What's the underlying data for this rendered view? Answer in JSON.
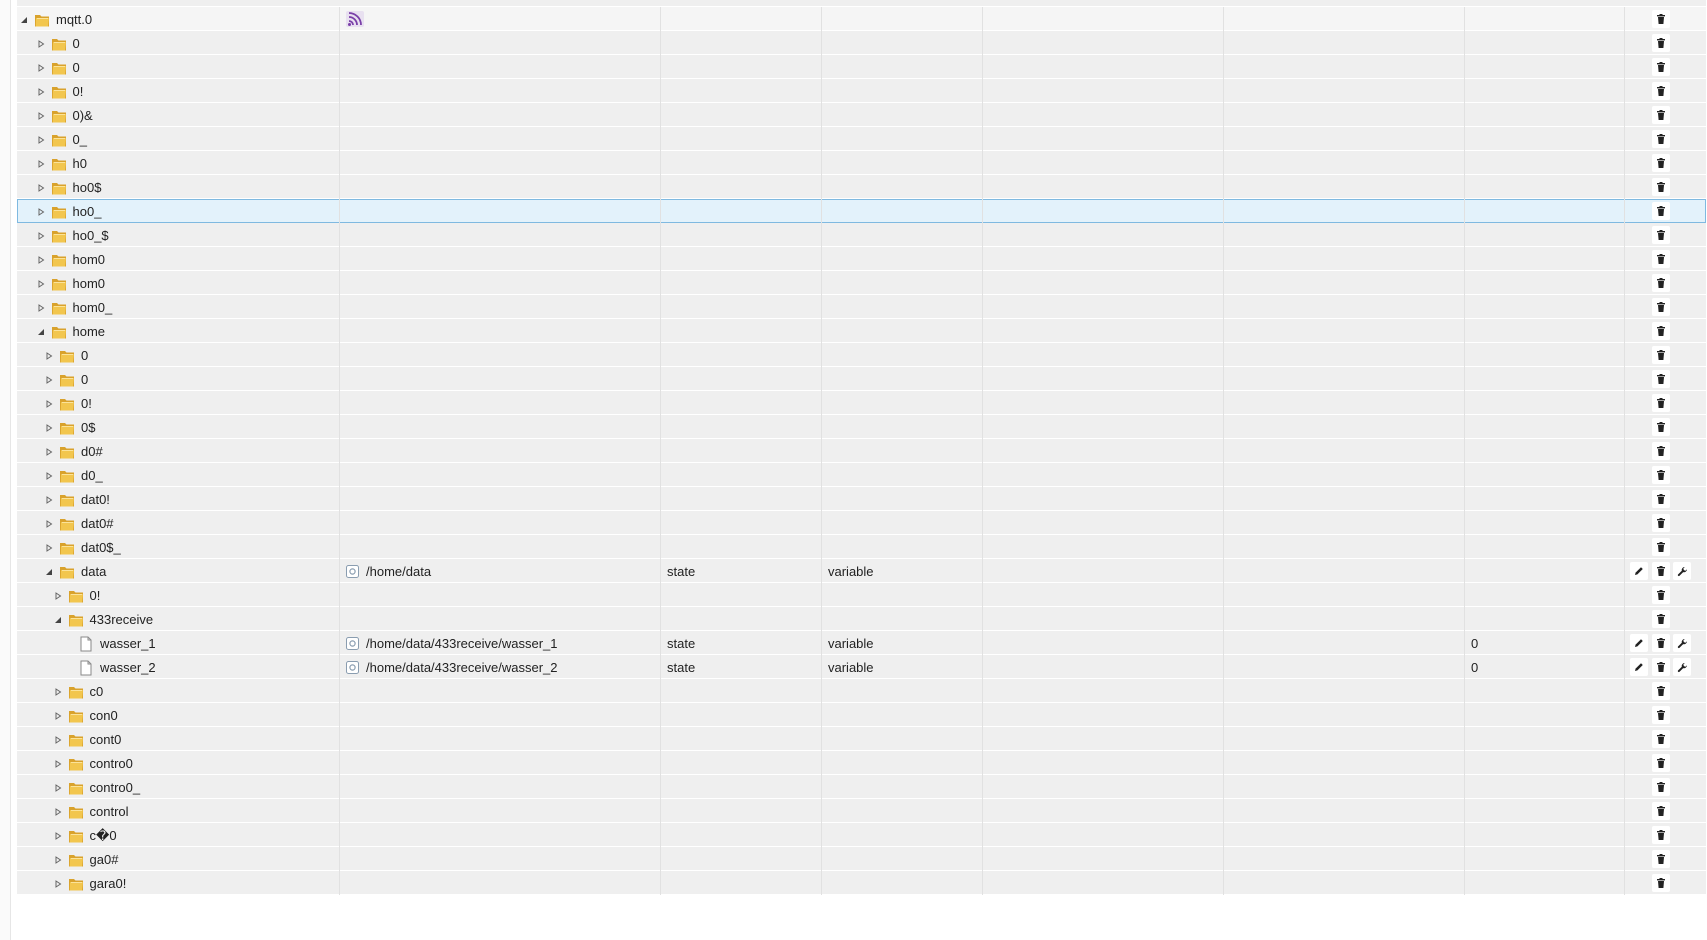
{
  "icons": {
    "folder": "folder-icon",
    "file": "file-icon",
    "state": "state-icon",
    "adapter": "mqtt-adapter-icon",
    "delete": "trash-icon",
    "edit": "pencil-icon",
    "config": "wrench-icon",
    "expanded": "triangle-down-icon",
    "collapsed": "triangle-right-icon"
  },
  "colors": {
    "row_bg": "#efefef",
    "selected_bg": "#e3f2fb",
    "selected_border": "#7fb9e0",
    "folder": "#e9b53c"
  },
  "rows": [
    {
      "name": "mqtt.0",
      "level": 0,
      "toggle": "expanded",
      "icon": "folder",
      "adapter": true,
      "root": true
    },
    {
      "name": "0",
      "level": 1,
      "toggle": "collapsed",
      "icon": "folder"
    },
    {
      "name": "0",
      "level": 1,
      "toggle": "collapsed",
      "icon": "folder"
    },
    {
      "name": "0!",
      "level": 1,
      "toggle": "collapsed",
      "icon": "folder"
    },
    {
      "name": "0)&",
      "level": 1,
      "toggle": "collapsed",
      "icon": "folder"
    },
    {
      "name": "0_",
      "level": 1,
      "toggle": "collapsed",
      "icon": "folder"
    },
    {
      "name": "h0",
      "level": 1,
      "toggle": "collapsed",
      "icon": "folder"
    },
    {
      "name": "ho0$",
      "level": 1,
      "toggle": "collapsed",
      "icon": "folder"
    },
    {
      "name": "ho0_",
      "level": 1,
      "toggle": "collapsed",
      "icon": "folder",
      "selected": true
    },
    {
      "name": "ho0_$",
      "level": 1,
      "toggle": "collapsed",
      "icon": "folder"
    },
    {
      "name": "hom0",
      "level": 1,
      "toggle": "collapsed",
      "icon": "folder"
    },
    {
      "name": "hom0",
      "level": 1,
      "toggle": "collapsed",
      "icon": "folder"
    },
    {
      "name": "hom0_",
      "level": 1,
      "toggle": "collapsed",
      "icon": "folder"
    },
    {
      "name": "home",
      "level": 1,
      "toggle": "expanded",
      "icon": "folder"
    },
    {
      "name": "0",
      "level": 2,
      "toggle": "collapsed",
      "icon": "folder"
    },
    {
      "name": "0",
      "level": 2,
      "toggle": "collapsed",
      "icon": "folder"
    },
    {
      "name": "0!",
      "level": 2,
      "toggle": "collapsed",
      "icon": "folder"
    },
    {
      "name": "0$",
      "level": 2,
      "toggle": "collapsed",
      "icon": "folder"
    },
    {
      "name": "d0#",
      "level": 2,
      "toggle": "collapsed",
      "icon": "folder"
    },
    {
      "name": "d0_",
      "level": 2,
      "toggle": "collapsed",
      "icon": "folder"
    },
    {
      "name": "dat0!",
      "level": 2,
      "toggle": "collapsed",
      "icon": "folder"
    },
    {
      "name": "dat0#",
      "level": 2,
      "toggle": "collapsed",
      "icon": "folder"
    },
    {
      "name": "dat0$_",
      "level": 2,
      "toggle": "collapsed",
      "icon": "folder"
    },
    {
      "name": "data",
      "level": 2,
      "toggle": "expanded",
      "icon": "folder",
      "id": "/home/data",
      "type": "state",
      "role": "variable",
      "actions": [
        "edit",
        "delete",
        "config"
      ]
    },
    {
      "name": "0!",
      "level": 3,
      "toggle": "collapsed",
      "icon": "folder"
    },
    {
      "name": "433receive",
      "level": 3,
      "toggle": "expanded",
      "icon": "folder"
    },
    {
      "name": "wasser_1",
      "level": 4,
      "toggle": "none",
      "icon": "file",
      "id": "/home/data/433receive/wasser_1",
      "type": "state",
      "role": "variable",
      "value": "0",
      "actions": [
        "edit",
        "delete",
        "config"
      ]
    },
    {
      "name": "wasser_2",
      "level": 4,
      "toggle": "none",
      "icon": "file",
      "id": "/home/data/433receive/wasser_2",
      "type": "state",
      "role": "variable",
      "value": "0",
      "actions": [
        "edit",
        "delete",
        "config"
      ]
    },
    {
      "name": "c0",
      "level": 3,
      "toggle": "collapsed",
      "icon": "folder"
    },
    {
      "name": "con0",
      "level": 3,
      "toggle": "collapsed",
      "icon": "folder"
    },
    {
      "name": "cont0",
      "level": 3,
      "toggle": "collapsed",
      "icon": "folder"
    },
    {
      "name": "contro0",
      "level": 3,
      "toggle": "collapsed",
      "icon": "folder"
    },
    {
      "name": "contro0_",
      "level": 3,
      "toggle": "collapsed",
      "icon": "folder"
    },
    {
      "name": "control",
      "level": 3,
      "toggle": "collapsed",
      "icon": "folder"
    },
    {
      "name": "c�0",
      "level": 3,
      "toggle": "collapsed",
      "icon": "folder"
    },
    {
      "name": "ga0#",
      "level": 3,
      "toggle": "collapsed",
      "icon": "folder"
    },
    {
      "name": "gara0!",
      "level": 3,
      "toggle": "collapsed",
      "icon": "folder"
    }
  ]
}
